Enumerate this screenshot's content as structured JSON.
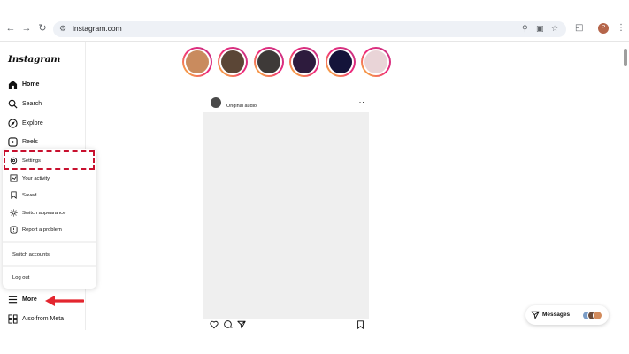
{
  "browser": {
    "url": "instagram.com",
    "profile_initial": "P"
  },
  "sidebar": {
    "logo": "Instagram",
    "items": [
      {
        "label": "Home",
        "icon": "home-icon"
      },
      {
        "label": "Search",
        "icon": "search-icon"
      },
      {
        "label": "Explore",
        "icon": "compass-icon"
      },
      {
        "label": "Reels",
        "icon": "reels-icon"
      }
    ],
    "more_label": "More",
    "meta_label": "Also from Meta"
  },
  "more_menu": {
    "items": [
      {
        "label": "Settings",
        "icon": "gear-icon"
      },
      {
        "label": "Your activity",
        "icon": "activity-icon"
      },
      {
        "label": "Saved",
        "icon": "bookmark-icon"
      },
      {
        "label": "Switch appearance",
        "icon": "sun-icon"
      },
      {
        "label": "Report a problem",
        "icon": "report-icon"
      }
    ],
    "switch_accounts": "Switch accounts",
    "log_out": "Log out"
  },
  "stories": [
    {
      "color": "#c98b5e"
    },
    {
      "color": "#5b4636"
    },
    {
      "color": "#3e3a38"
    },
    {
      "color": "#2d1b3d"
    },
    {
      "color": "#14143a"
    },
    {
      "color": "#e9d4d7"
    }
  ],
  "post": {
    "audio_label": "Original audio",
    "more": "···"
  },
  "messages": {
    "label": "Messages"
  },
  "colors": {
    "highlight": "#c8102e",
    "arrow": "#e3262f"
  }
}
